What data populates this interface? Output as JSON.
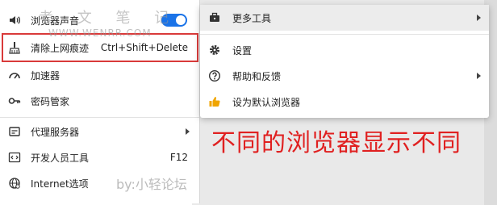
{
  "colors": {
    "accent": "#1a73e8",
    "highlight_border": "#d93a3a",
    "annotation": "#e02020",
    "background_gray": "#e9e9e9"
  },
  "left_menu": {
    "items": [
      {
        "label": "浏览器声音",
        "icon": "speaker-icon",
        "toggle_on": true
      },
      {
        "label": "清除上网痕迹",
        "icon": "broom-icon",
        "shortcut": "Ctrl+Shift+Delete"
      },
      {
        "label": "加速器",
        "icon": "speedometer-icon"
      },
      {
        "label": "密码管家",
        "icon": "key-icon"
      },
      {
        "label": "代理服务器",
        "icon": "proxy-server-icon",
        "has_submenu": true
      },
      {
        "label": "开发人员工具",
        "icon": "code-icon",
        "shortcut": "F12"
      },
      {
        "label": "Internet选项",
        "icon": "globe-icon"
      }
    ]
  },
  "right_menu": {
    "items": [
      {
        "label": "更多工具",
        "icon": "toolbox-icon",
        "has_submenu": true,
        "active": true
      },
      {
        "label": "设置",
        "icon": "gear-icon"
      },
      {
        "label": "帮助和反馈",
        "icon": "help-icon",
        "has_submenu": true
      },
      {
        "label": "设为默认浏览器",
        "icon": "thumbs-up-icon"
      }
    ]
  },
  "annotation": "不同的浏览器显示不同",
  "watermark": {
    "title": "考 文 笔 记",
    "url": "WWW.WENRR.COM",
    "credit": "by:小轻论坛"
  }
}
